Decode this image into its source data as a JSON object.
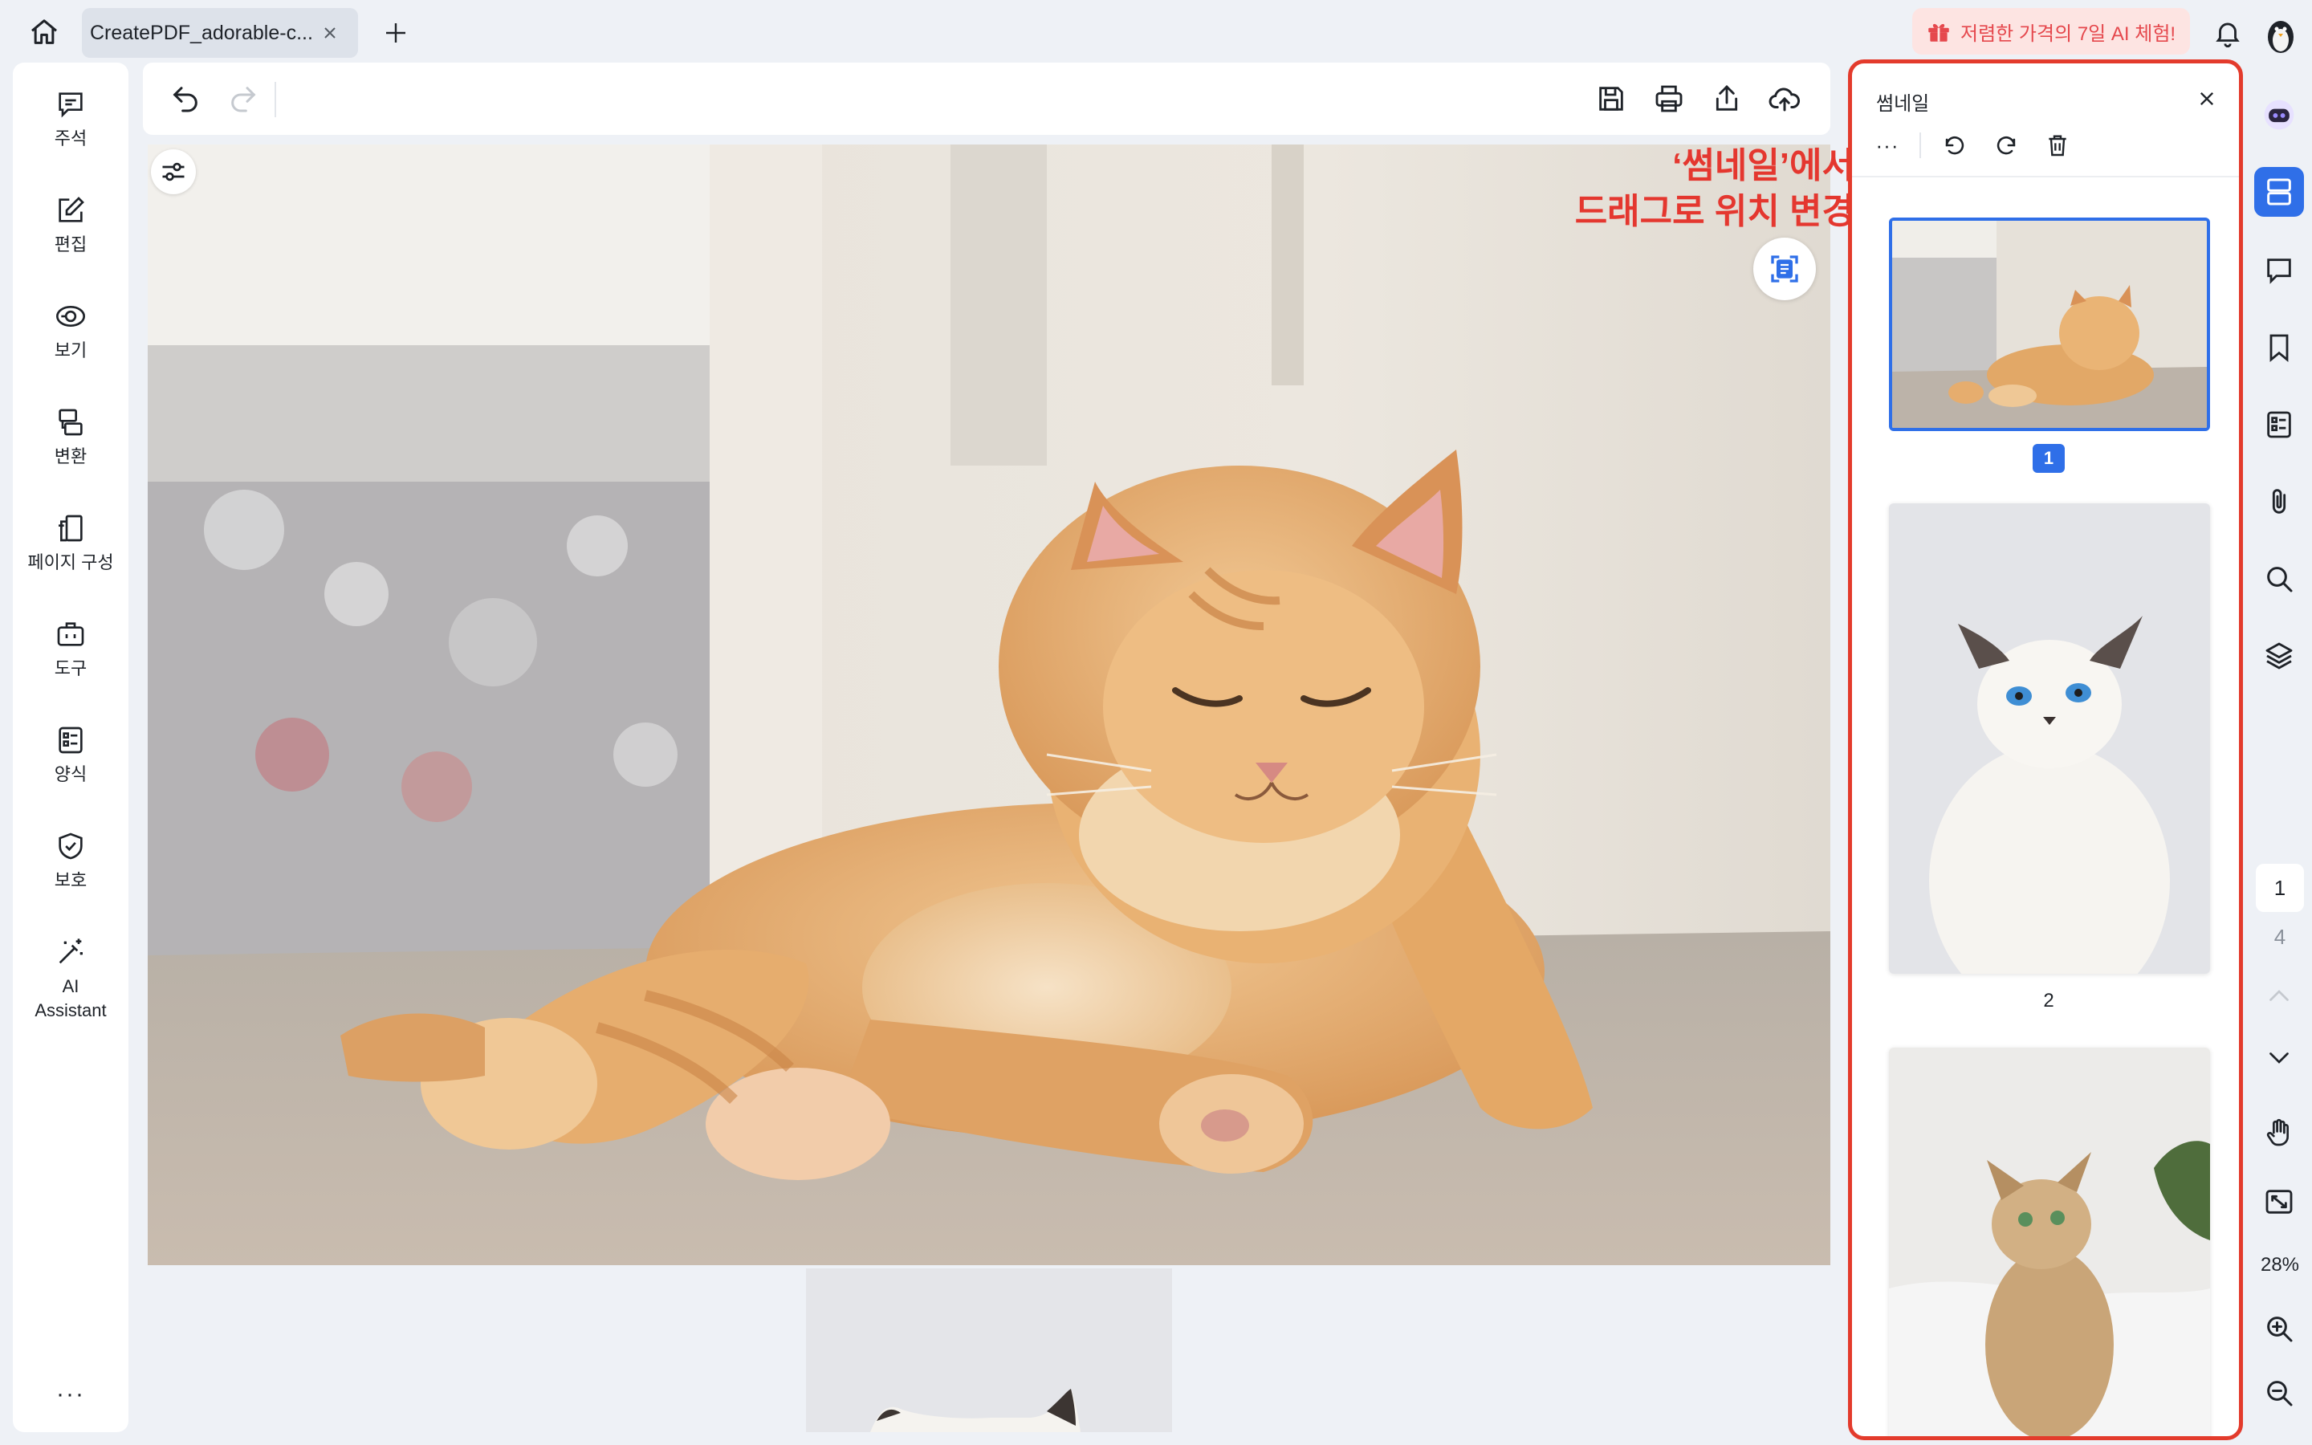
{
  "tab": {
    "title": "CreatePDF_adorable-c..."
  },
  "promo": {
    "text": "저렴한 가격의 7일 AI 체험!"
  },
  "sidebar": {
    "items": [
      {
        "label": "주석",
        "icon": "comment-icon"
      },
      {
        "label": "편집",
        "icon": "edit-icon"
      },
      {
        "label": "보기",
        "icon": "eye-icon"
      },
      {
        "label": "변환",
        "icon": "convert-icon"
      },
      {
        "label": "페이지 구성",
        "icon": "page-organize-icon"
      },
      {
        "label": "도구",
        "icon": "toolbox-icon"
      },
      {
        "label": "양식",
        "icon": "form-icon"
      },
      {
        "label": "보호",
        "icon": "shield-icon"
      },
      {
        "label": "AI\nAssistant",
        "icon": "ai-wand-icon"
      }
    ],
    "more": "···"
  },
  "annotation": {
    "line1": "‘썸네일’에서",
    "line2": "드래그로 위치 변경"
  },
  "thumbnails": {
    "title": "썸네일",
    "more": "···",
    "pages": [
      {
        "label": "1",
        "selected": true
      },
      {
        "label": "2"
      }
    ]
  },
  "navigation": {
    "current_page": "1",
    "total_pages": "4"
  },
  "zoom": {
    "level": "28%"
  },
  "colors": {
    "accent": "#2f6fe8",
    "highlight": "#e33b2c",
    "promo": "#e5484d"
  }
}
